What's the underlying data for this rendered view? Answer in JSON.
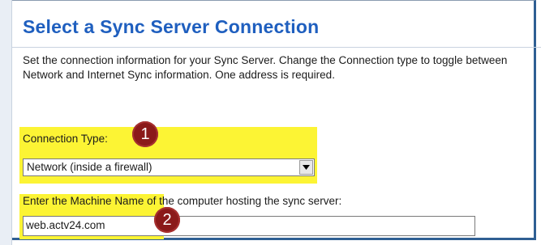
{
  "page": {
    "title": "Select a Sync Server Connection",
    "description": "Set the connection information for your Sync Server. Change the Connection type to toggle between Network and Internet Sync information. One address is required."
  },
  "connection_type": {
    "label": "Connection Type:",
    "selected": "Network (inside a firewall)"
  },
  "machine_name": {
    "label": "Enter the Machine Name of the computer hosting the sync server:",
    "value": "web.actv24.com"
  },
  "annotations": {
    "badge_1": "1",
    "badge_2": "2"
  },
  "colors": {
    "title": "#1f5fbf",
    "highlight": "#fcf434",
    "badge": "#8b1a1a"
  }
}
